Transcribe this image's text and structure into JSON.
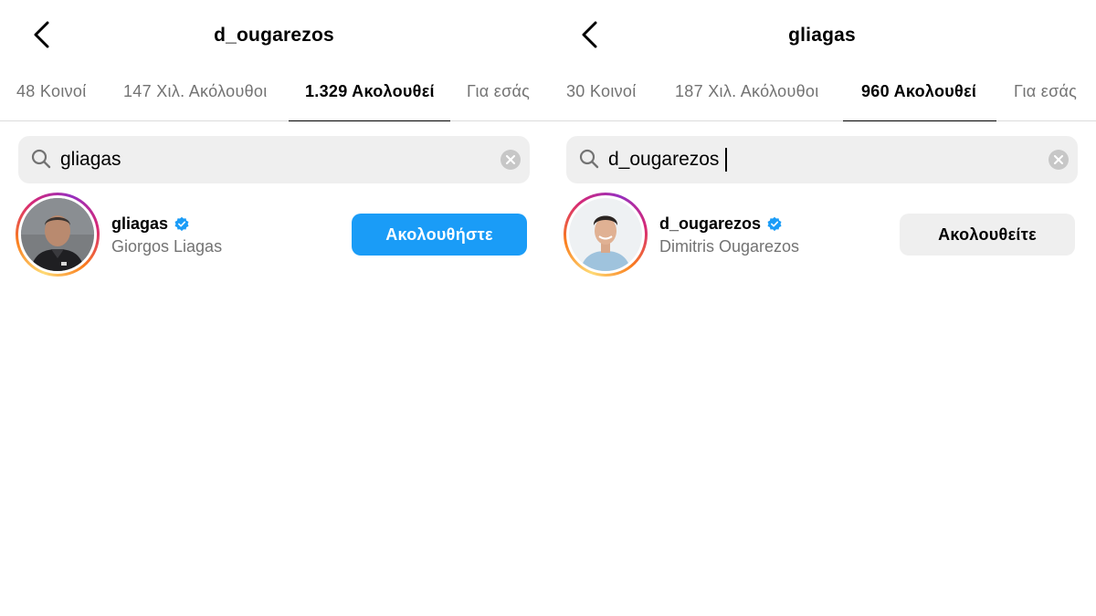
{
  "left_panel": {
    "title": "d_ougarezos",
    "tabs": [
      {
        "label": "48 Κοινοί"
      },
      {
        "label": "147 Χιλ. Ακόλουθοι"
      },
      {
        "label": "1.329 Ακολουθεί",
        "active": true
      },
      {
        "label": "Για εσάς"
      }
    ],
    "search": {
      "value": "gliagas",
      "placeholder": ""
    },
    "result": {
      "username": "gliagas",
      "verified": true,
      "full_name": "Giorgos Liagas",
      "button_label": "Ακολουθήστε"
    }
  },
  "right_panel": {
    "title": "gliagas",
    "tabs": [
      {
        "label": "30 Κοινοί"
      },
      {
        "label": "187 Χιλ. Ακόλουθοι"
      },
      {
        "label": "960 Ακολουθεί",
        "active": true
      },
      {
        "label": "Για εσάς"
      }
    ],
    "search": {
      "value": "d_ougarezos",
      "placeholder": ""
    },
    "result": {
      "username": "d_ougarezos",
      "verified": true,
      "full_name": "Dimitris Ougarezos",
      "button_label": "Ακολουθείτε"
    }
  },
  "colors": {
    "follow_button": "#1a9cf7",
    "following_button": "#efefef",
    "verified_badge": "#1a9cf7",
    "secondary_text": "#737373"
  },
  "icons": [
    "back-chevron-icon",
    "search-icon",
    "clear-icon",
    "verified-badge-icon"
  ]
}
